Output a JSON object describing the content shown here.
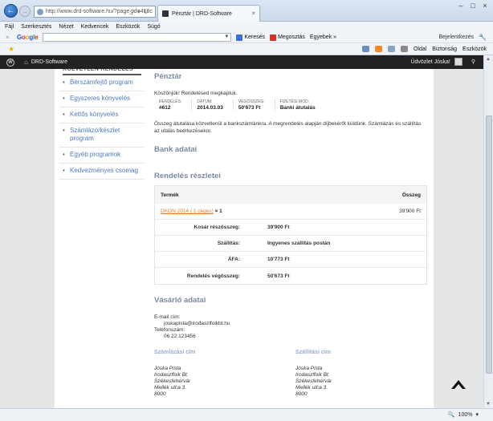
{
  "browser": {
    "address": "http://www.drd-software.hu/?page_id=418c",
    "tab_title": "Pénztár | DRD-Software",
    "menu": [
      "Fájl",
      "Szerkesztés",
      "Nézet",
      "Kedvencek",
      "Eszközök",
      "Súgó"
    ],
    "toolbar": {
      "search_btn": "Keresés",
      "share_btn": "Megosztás",
      "more_btn": "Egyebek »",
      "login": "Bejelentkezés"
    },
    "command": [
      "Oldal",
      "Biztonság",
      "Eszközök"
    ],
    "zoom": "100%"
  },
  "admin_bar": {
    "site_name": "DRD-Software",
    "greeting": "Üdvözlet Jóska!"
  },
  "sidebar": {
    "heading": "KÖZVETLEN RENDELÉS",
    "items": [
      "Bérszámfejtő program",
      "Egyszeres könyvelés",
      "Kettős könyvelés",
      "Számlázó/készlet program",
      "Egyéb programok",
      "Kedvezményes csomag"
    ]
  },
  "checkout": {
    "title": "Pénztár",
    "thanks": "Köszönjük! Rendelésed megkaptuk.",
    "order": [
      {
        "label": "RENDELÉS:",
        "value": "#612"
      },
      {
        "label": "DÁTUM:",
        "value": "2014.03.03"
      },
      {
        "label": "VÉGÖSSZEG:",
        "value": "50'673 Ft"
      },
      {
        "label": "FIZETÉSI MÓD:",
        "value": "Banki átutalás"
      }
    ],
    "note": "Összeg átutalása közvetlenül a bankszámlánkra. A megrendelés alapján díjbekérőt küldünk. Számlázás és szállítás az utalás beérkezésekor.",
    "bank_title": "Bank adatai",
    "details_title": "Rendelés részletei",
    "table": {
      "col_product": "Termék",
      "col_total": "Összeg",
      "product_name": "DKON 2014 ( 1 céges)",
      "product_qty": "× 1",
      "product_price": "39'900 Ft",
      "totals": [
        {
          "label": "Kosár részösszeg:",
          "value": "39'900 Ft"
        },
        {
          "label": "Szállítás:",
          "value": "Ingyenes szállítás postán"
        },
        {
          "label": "ÁFA:",
          "value": "10'773 Ft"
        },
        {
          "label": "Rendelés végösszeg:",
          "value": "50'673 Ft"
        }
      ]
    },
    "customer_title": "Vásárló adatai",
    "email_label": "E-mail cím:",
    "email": "joskapista@irodaszlfoikbt.hu",
    "phone_label": "Telefonszám:",
    "phone": "06 22 123456",
    "billing": {
      "title": "Számlázási cím",
      "lines": [
        "Jóska Pista",
        "Irodaszlfoik Bt.",
        "Székesfehérvár",
        "Mellék utca 3.",
        "8000"
      ]
    },
    "shipping": {
      "title": "Szállítási cím",
      "lines": [
        "Jóska Pista",
        "Irodaszlfoik Bt.",
        "Székesfehérvár",
        "Mellék utca 3.",
        "8000"
      ]
    }
  }
}
